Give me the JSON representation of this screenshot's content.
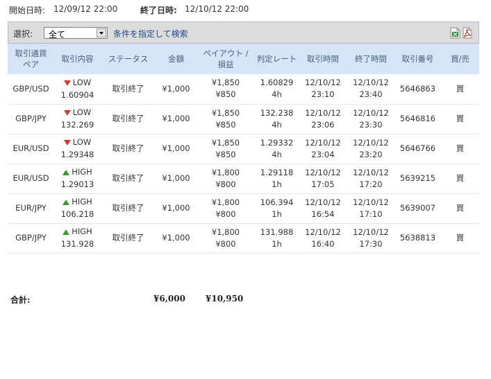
{
  "period": {
    "start_label": "開始日時:",
    "start_value": "12/09/12 22:00",
    "end_label": "終了日時:",
    "end_value": "12/10/12 22:00"
  },
  "filter": {
    "select_label": "選択:",
    "select_value": "全て",
    "condition_link": "条件を指定して検索",
    "icons": [
      "csv-export-icon",
      "pdf-export-icon"
    ]
  },
  "columns": [
    "取引通貨ペア",
    "取引内容",
    "ステータス",
    "金額",
    "ペイアウト/損益",
    "判定レート",
    "取引時間",
    "終了時間",
    "取引番号",
    "買/売"
  ],
  "column_lines": [
    [
      "取引通貨",
      "ペア"
    ],
    [
      "取引内容"
    ],
    [
      "ステータス"
    ],
    [
      "金額"
    ],
    [
      "ペイアウト /",
      "損益"
    ],
    [
      "判定レート"
    ],
    [
      "取引時間"
    ],
    [
      "終了時間"
    ],
    [
      "取引番号"
    ],
    [
      "買/売"
    ]
  ],
  "rows": [
    {
      "pair": "GBP/USD",
      "direction": "LOW",
      "rate": "1.60904",
      "status": "取引終了",
      "amount": "¥1,000",
      "payout": "¥1,850",
      "pl": "¥850",
      "judge_rate": "1.60829",
      "duration": "4h",
      "trade_date": "12/10/12",
      "trade_time": "23:10",
      "end_date": "12/10/12",
      "end_time": "23:40",
      "trade_no": "5646863",
      "side": "買"
    },
    {
      "pair": "GBP/JPY",
      "direction": "LOW",
      "rate": "132.269",
      "status": "取引終了",
      "amount": "¥1,000",
      "payout": "¥1,850",
      "pl": "¥850",
      "judge_rate": "132.238",
      "duration": "4h",
      "trade_date": "12/10/12",
      "trade_time": "23:06",
      "end_date": "12/10/12",
      "end_time": "23:30",
      "trade_no": "5646816",
      "side": "買"
    },
    {
      "pair": "EUR/USD",
      "direction": "LOW",
      "rate": "1.29348",
      "status": "取引終了",
      "amount": "¥1,000",
      "payout": "¥1,850",
      "pl": "¥850",
      "judge_rate": "1.29332",
      "duration": "4h",
      "trade_date": "12/10/12",
      "trade_time": "23:04",
      "end_date": "12/10/12",
      "end_time": "23:20",
      "trade_no": "5646766",
      "side": "買"
    },
    {
      "pair": "EUR/USD",
      "direction": "HIGH",
      "rate": "1.29013",
      "status": "取引終了",
      "amount": "¥1,000",
      "payout": "¥1,800",
      "pl": "¥800",
      "judge_rate": "1.29118",
      "duration": "1h",
      "trade_date": "12/10/12",
      "trade_time": "17:05",
      "end_date": "12/10/12",
      "end_time": "17:20",
      "trade_no": "5639215",
      "side": "買"
    },
    {
      "pair": "EUR/JPY",
      "direction": "HIGH",
      "rate": "106.218",
      "status": "取引終了",
      "amount": "¥1,000",
      "payout": "¥1,800",
      "pl": "¥800",
      "judge_rate": "106.394",
      "duration": "1h",
      "trade_date": "12/10/12",
      "trade_time": "16:54",
      "end_date": "12/10/12",
      "end_time": "17:10",
      "trade_no": "5639007",
      "side": "買"
    },
    {
      "pair": "GBP/JPY",
      "direction": "HIGH",
      "rate": "131.928",
      "status": "取引終了",
      "amount": "¥1,000",
      "payout": "¥1,800",
      "pl": "¥800",
      "judge_rate": "131.988",
      "duration": "1h",
      "trade_date": "12/10/12",
      "trade_time": "16:40",
      "end_date": "12/10/12",
      "end_time": "17:30",
      "trade_no": "5638813",
      "side": "買"
    }
  ],
  "totals": {
    "label": "合計:",
    "amount": "¥6,000",
    "pl": "¥10,950"
  },
  "colors": {
    "low_arrow": "#d03a2a",
    "high_arrow": "#3d9a2e",
    "header_bg": "#d5e5f7",
    "header_text": "#4a5f7c",
    "link": "#1e4d8c"
  }
}
